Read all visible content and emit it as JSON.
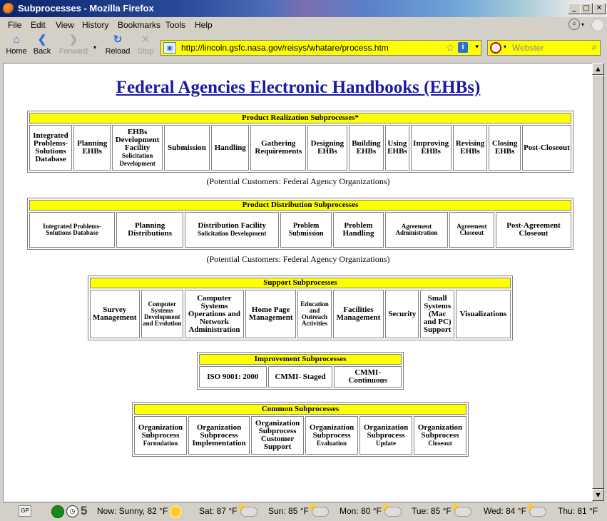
{
  "window": {
    "title": "Subprocesses - Mozilla Firefox"
  },
  "menu": [
    "File",
    "Edit",
    "View",
    "History",
    "Bookmarks",
    "Tools",
    "Help"
  ],
  "nav": {
    "back": "Back",
    "home": "Home",
    "forward": "Forward",
    "reload": "Reload",
    "stop": "Stop"
  },
  "address": {
    "url": "http://lincoln.gsfc.nasa.gov/reisys/whatare/process.htm"
  },
  "search": {
    "placeholder": "Webster"
  },
  "page": {
    "title": "Federal Agencies Electronic Handbooks (EHBs)",
    "realization": {
      "header": "Product Realization Subprocesses*",
      "cells": {
        "c1": "Integrated Problems-Solutions Database",
        "c2": "Planning EHBs",
        "c3a": "EHBs Development Facility",
        "c3b": "Solicitation Development",
        "c4": "Submission",
        "c5": "Handling",
        "c6": "Gathering Requirements",
        "c7": "Designing EHBs",
        "c8": "Building EHBs",
        "c9": "Using EHBs",
        "c10": "Improving EHBs",
        "c11": "Revising EHBs",
        "c12": "Closing EHBs",
        "c13": "Post-Closeout"
      },
      "customers": "(Potential Customers: Federal Agency Organizations)"
    },
    "distribution": {
      "header": "Product Distribution Subprocesses",
      "cells": {
        "c1": "Integrated Problems-Solutions Database",
        "c2": "Planning Distributions",
        "c3": "Distribution Facility",
        "c3b": "Solicitation Development",
        "c4": "Problem Submission",
        "c5": "Problem Handling",
        "c6": "Agreement Administration",
        "c7": "Agreement Closeout",
        "c8": "Post-Agreement Closeout"
      },
      "customers": "(Potential Customers: Federal Agency Organizations)"
    },
    "support": {
      "header": "Support Subprocesses",
      "cells": {
        "c1": "Survey Management",
        "c2": "Computer Systems Development and Evolution",
        "c3": "Computer Systems Operations and Network Administration",
        "c4": "Home Page Management",
        "c5": "Education and Outreach Activities",
        "c6": "Facilities Management",
        "c7": "Security",
        "c8": "Small Systems (Mac and PC) Support",
        "c9": "Visualizations"
      }
    },
    "improvement": {
      "header": "Improvement Subprocesses",
      "cells": {
        "c1": "ISO 9001: 2000",
        "c2": "CMMI- Staged",
        "c3": "CMMI- Continuous"
      }
    },
    "common": {
      "header": "Common Subprocesses",
      "cells": {
        "c1": "Organization Subprocess",
        "c1b": "Formulation",
        "c2": "Organization Subprocess Implementation",
        "c3": "Organization Subprocess Customer Support",
        "c4": "Organization Subprocess",
        "c4b": "Evaluation",
        "c5": "Organization Subprocess",
        "c5b": "Update",
        "c6": "Organization Subprocess",
        "c6b": "Closeout"
      }
    }
  },
  "status": {
    "gp": "GP",
    "count": "5",
    "now": "Now: Sunny, 82 °F",
    "sat": "Sat: 87 °F",
    "sun": "Sun: 85 °F",
    "mon": "Mon: 80 °F",
    "tue": "Tue: 85 °F",
    "wed": "Wed: 84 °F",
    "thu": "Thu: 81 °F"
  }
}
